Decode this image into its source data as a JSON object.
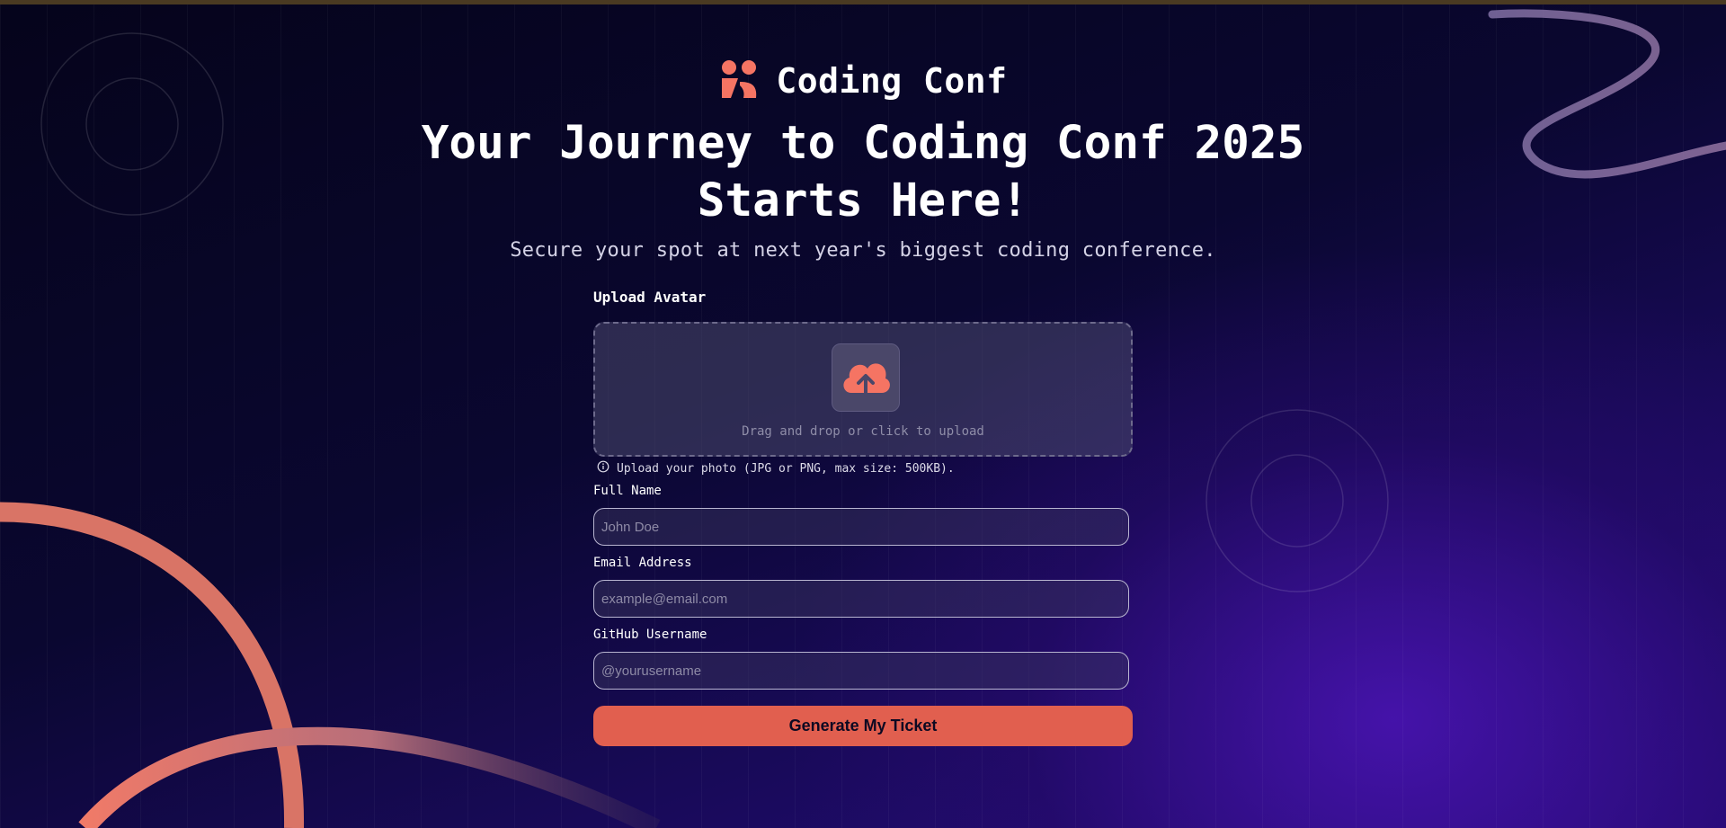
{
  "brand": {
    "name": "Coding Conf"
  },
  "hero": {
    "title": "Your Journey to Coding Conf 2025 Starts Here!",
    "subtitle": "Secure your spot at next year's biggest coding conference."
  },
  "form": {
    "avatar_label": "Upload Avatar",
    "upload_prompt": "Drag and drop or click to upload",
    "upload_hint": "Upload your photo (JPG or PNG, max size: 500KB).",
    "full_name": {
      "label": "Full Name",
      "placeholder": "John Doe"
    },
    "email": {
      "label": "Email Address",
      "placeholder": "example@email.com"
    },
    "github": {
      "label": "GitHub Username",
      "placeholder": "@yourusername"
    },
    "submit_label": "Generate My Ticket"
  },
  "colors": {
    "accent": "#e15f4f",
    "background": "#070524",
    "gradient_end": "#2b0c86"
  },
  "icons": {
    "logo": "coding-conf-logo-icon",
    "upload": "cloud-upload-icon",
    "info": "info-circle-icon"
  }
}
